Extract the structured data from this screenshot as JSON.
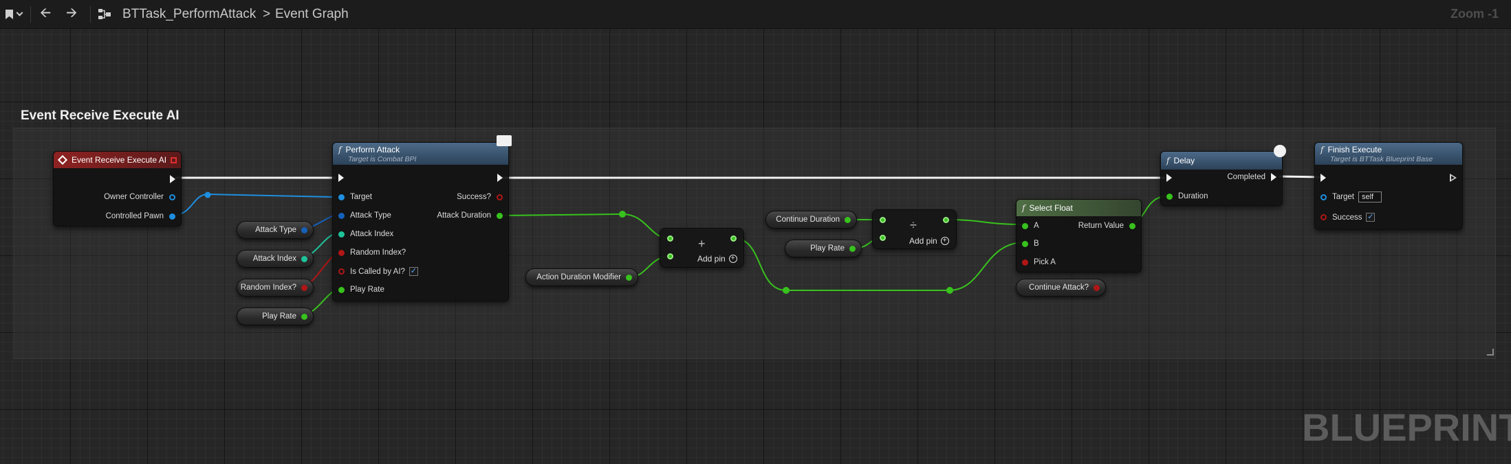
{
  "toolbar": {
    "breadcrumb_asset": "BTTask_PerformAttack",
    "breadcrumb_sep": ">",
    "breadcrumb_graph": "Event Graph",
    "zoom": "Zoom -1"
  },
  "comment": {
    "title": "Event Receive Execute AI"
  },
  "nodes": {
    "event": {
      "title": "Event Receive Execute AI",
      "pins": [
        "Owner Controller",
        "Controlled Pawn"
      ]
    },
    "perform_attack": {
      "title": "Perform Attack",
      "subtitle": "Target is Combat BPI",
      "inputs": [
        "Target",
        "Attack Type",
        "Attack Index",
        "Random Index?",
        "Is Called by AI?",
        "Play Rate"
      ],
      "outputs": [
        "Success?",
        "Attack Duration"
      ]
    },
    "add": {
      "add_pin": "Add pin",
      "symbol": "+"
    },
    "divide": {
      "add_pin": "Add pin",
      "symbol": "÷"
    },
    "select_float": {
      "title": "Select Float",
      "inputs": [
        "A",
        "B",
        "Pick A"
      ],
      "output": "Return Value"
    },
    "delay": {
      "title": "Delay",
      "input": "Duration",
      "output": "Completed"
    },
    "finish_execute": {
      "title": "Finish Execute",
      "subtitle": "Target is BTTask Blueprint Base",
      "target_label": "Target",
      "target_value": "self",
      "success_label": "Success"
    }
  },
  "variables": {
    "attack_type": "Attack Type",
    "attack_index": "Attack Index",
    "random_index": "Random Index?",
    "play_rate_1": "Play Rate",
    "action_duration_modifier": "Action Duration Modifier",
    "continue_duration": "Continue Duration",
    "play_rate_2": "Play Rate",
    "continue_attack": "Continue Attack?"
  },
  "watermark": "BLUEPRINT",
  "colors": {
    "exec": "#f0f0f0",
    "float_pin": "#38c21e",
    "object_pin": "#1e8fe0",
    "bool_pin": "#b01616",
    "int_pin": "#1dc49a",
    "enum_pin": "#1560b8",
    "event_header": "#8e2222",
    "function_header": "#4c6a88",
    "pure_header": "#4f6e44"
  }
}
